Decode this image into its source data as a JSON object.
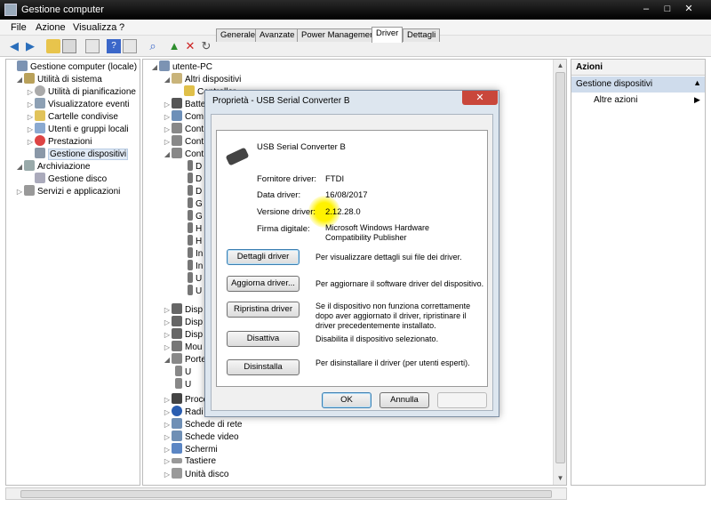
{
  "window": {
    "title": "Gestione computer",
    "min": "–",
    "max": "□",
    "close": "✕"
  },
  "menu": {
    "file": "File",
    "azione": "Azione",
    "visualizza": "Visualizza",
    "help": "?"
  },
  "left_tree": [
    {
      "label": "Gestione computer (locale)",
      "icon": "computer-icon"
    },
    {
      "label": "Utilità di sistema",
      "icon": "tools-icon"
    },
    {
      "label": "Utilità di pianificazione",
      "icon": "clock-icon"
    },
    {
      "label": "Visualizzatore eventi",
      "icon": "event-viewer-icon"
    },
    {
      "label": "Cartelle condivise",
      "icon": "shared-folder-icon"
    },
    {
      "label": "Utenti e gruppi locali",
      "icon": "users-icon"
    },
    {
      "label": "Prestazioni",
      "icon": "performance-icon"
    },
    {
      "label": "Gestione dispositivi",
      "icon": "device-manager-icon"
    },
    {
      "label": "Archiviazione",
      "icon": "storage-icon"
    },
    {
      "label": "Gestione disco",
      "icon": "disk-icon"
    },
    {
      "label": "Servizi e applicazioni",
      "icon": "services-icon"
    }
  ],
  "mid_tree": {
    "root": "utente-PC",
    "altri": "Altri dispositivi",
    "controller": "Controller",
    "partials": [
      "Batte",
      "Com",
      "Cont",
      "Cont",
      "Cont"
    ],
    "sub_letters": [
      "D",
      "D",
      "D",
      "G",
      "G",
      "H",
      "H",
      "In",
      "In",
      "U",
      "U"
    ],
    "partials2": [
      "Disp",
      "Disp",
      "Disp",
      "Mou",
      "Porte"
    ],
    "ports": [
      "U",
      "U"
    ],
    "bottom": [
      "Proce",
      "Radi",
      "Schede di rete",
      "Schede video",
      "Schermi",
      "Tastiere",
      "Unità disco"
    ]
  },
  "actions": {
    "header": "Azioni",
    "selected": "Gestione dispositivi",
    "more": "Altre azioni"
  },
  "dialog": {
    "title": "Proprietà - USB Serial Converter B",
    "close": "✕",
    "tabs": [
      "Generale",
      "Avanzate",
      "Power Management",
      "Driver",
      "Dettagli"
    ],
    "device_name": "USB Serial Converter B",
    "fields": [
      {
        "label": "Fornitore driver:",
        "value": "FTDI"
      },
      {
        "label": "Data driver:",
        "value": "16/08/2017"
      },
      {
        "label": "Versione driver:",
        "value": "2.12.28.0"
      },
      {
        "label": "Firma digitale:",
        "value": "Microsoft Windows Hardware Compatibility Publisher"
      }
    ],
    "buttons": [
      {
        "label": "Dettagli driver",
        "desc": "Per visualizzare dettagli sui file dei driver."
      },
      {
        "label": "Aggiorna driver...",
        "desc": "Per aggiornare il software driver del dispositivo."
      },
      {
        "label": "Ripristina driver",
        "desc": "Se il dispositivo non funziona correttamente dopo aver aggiornato il driver, ripristinare il driver precedentemente installato."
      },
      {
        "label": "Disattiva",
        "desc": "Disabilita il dispositivo selezionato."
      },
      {
        "label": "Disinstalla",
        "desc": "Per disinstallare il driver (per utenti esperti)."
      }
    ],
    "ok": "OK",
    "cancel": "Annulla",
    "apply": ""
  },
  "colors": {
    "titlebar": "#000000",
    "selection": "#cfdcec",
    "dialog_frame": "#dde6ef",
    "highlight": "#fff200"
  }
}
